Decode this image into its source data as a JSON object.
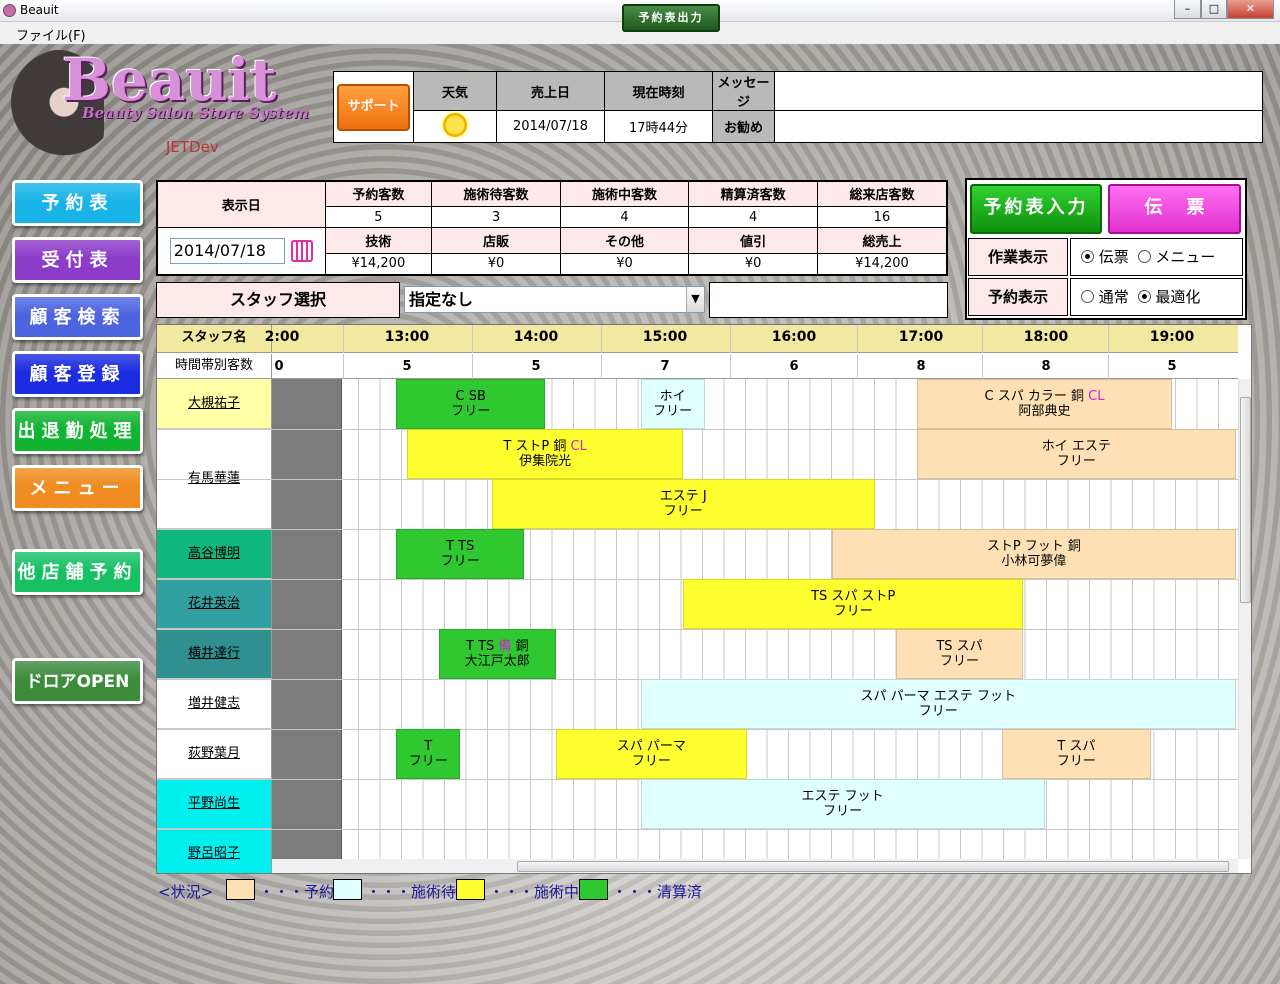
{
  "window": {
    "title": "Beauit",
    "menu_file": "ファイル(F)",
    "min": "–",
    "max": "□",
    "close": "✕"
  },
  "logo": {
    "brand": "Beauit",
    "tagline": "Beauty Salon Store System",
    "dev": "JETDev"
  },
  "support_label": "サポート",
  "info": {
    "h_weather": "天気",
    "h_salesdate": "売上日",
    "h_time": "現在時刻",
    "h_message": "メッセージ",
    "weather_icon": "sun-icon",
    "sales_date": "2014/07/18",
    "current_time": "17時44分",
    "message_label": "お勧め",
    "message_value": ""
  },
  "nav": [
    {
      "label": "予約表",
      "color": "#18b4e8"
    },
    {
      "label": "受付表",
      "color": "#8c3cc8"
    },
    {
      "label": "顧客検索",
      "color": "#4c64e0"
    },
    {
      "label": "顧客登録",
      "color": "#1c2ce0"
    },
    {
      "label": "出退勤処理",
      "color": "#10b430"
    },
    {
      "label": "メニュー",
      "color": "#f08c20"
    },
    {
      "label": "他店舗予約",
      "color": "#18c064"
    },
    {
      "label": "ドロアOPEN",
      "color": "#3c8c3c"
    }
  ],
  "summary": {
    "date_label": "表示日",
    "date_value": "2014/07/18",
    "h1": [
      "予約客数",
      "施術待客数",
      "施術中客数",
      "精算済客数",
      "総来店客数"
    ],
    "v1": [
      "5",
      "3",
      "4",
      "4",
      "16"
    ],
    "h2": [
      "技術",
      "店販",
      "その他",
      "値引",
      "総売上"
    ],
    "v2": [
      "¥14,200",
      "¥0",
      "¥0",
      "¥0",
      "¥14,200"
    ]
  },
  "staff_select": {
    "label": "スタッフ選択",
    "value": "指定なし",
    "output_button": "予約表出力"
  },
  "right": {
    "reserve_input": "予約表入力",
    "slip": "伝票",
    "work_label": "作業表示",
    "work_opt1": "伝票",
    "work_opt2": "メニュー",
    "work_selected": "伝票",
    "resv_label": "予約表示",
    "resv_opt1": "通常",
    "resv_opt2": "最適化",
    "resv_selected": "最適化"
  },
  "schedule": {
    "col_staff": "スタッフ名",
    "row_counts": "時間帯別客数",
    "hours": [
      "2:00",
      "13:00",
      "14:00",
      "15:00",
      "16:00",
      "17:00",
      "18:00",
      "19:00"
    ],
    "counts": [
      "0",
      "5",
      "5",
      "7",
      "6",
      "8",
      "8",
      "5"
    ],
    "staff": [
      {
        "name": "大槻祐子",
        "color": "#ffffa8"
      },
      {
        "name": "有馬華蓮",
        "color": "#ffffff"
      },
      {
        "name": "高谷博明",
        "color": "#10b880"
      },
      {
        "name": "花井英治",
        "color": "#30a0a0"
      },
      {
        "name": "横井達行",
        "color": "#309090"
      },
      {
        "name": "増井健志",
        "color": "#ffffff"
      },
      {
        "name": "荻野葉月",
        "color": "#ffffff"
      },
      {
        "name": "平野尚生",
        "color": "#00f0f0"
      },
      {
        "name": "野呂昭子",
        "color": "#00f0f0"
      }
    ],
    "blocks": [
      {
        "row": 0,
        "start": "12:55",
        "end": "14:05",
        "status": "清算済",
        "l1": "C SB",
        "cl": "",
        "l2": "フリー"
      },
      {
        "row": 0,
        "start": "14:50",
        "end": "15:20",
        "status": "施術待",
        "l1": "ホイ",
        "cl": "",
        "l2": "フリー"
      },
      {
        "row": 0,
        "start": "17:00",
        "end": "19:00",
        "status": "予約",
        "l1": "C スパ カラー 銅 ",
        "cl": "CL",
        "l2": "阿部典史"
      },
      {
        "row": 1,
        "start": "13:00",
        "end": "15:10",
        "status": "施術中",
        "l1": "T ストP 銅 ",
        "cl": "CL",
        "l2": "伊集院光"
      },
      {
        "row": 1,
        "start": "17:00",
        "end": "19:30",
        "status": "予約",
        "l1": "ホイ エステ",
        "cl": "",
        "l2": "フリー"
      },
      {
        "row": 1.5,
        "start": "13:40",
        "end": "16:40",
        "status": "施術中",
        "l1": "エステ J",
        "cl": "",
        "l2": "フリー"
      },
      {
        "row": 2,
        "start": "12:55",
        "end": "13:55",
        "status": "清算済",
        "l1": "T TS",
        "cl": "",
        "l2": "フリー"
      },
      {
        "row": 2,
        "start": "16:20",
        "end": "19:30",
        "status": "予約",
        "l1": "ストP フット 銅",
        "cl": "",
        "l2": "小林可夢偉"
      },
      {
        "row": 3,
        "start": "15:10",
        "end": "17:50",
        "status": "施術中",
        "l1": "TS スパ ストP",
        "cl": "",
        "l2": "フリー"
      },
      {
        "row": 4,
        "start": "13:15",
        "end": "14:10",
        "status": "清算済",
        "l1": "T TS ",
        "cl": "備",
        "l2": "大江戸太郎",
        "tail": " 銅"
      },
      {
        "row": 4,
        "start": "16:50",
        "end": "17:50",
        "status": "予約",
        "l1": "TS スパ",
        "cl": "",
        "l2": "フリー"
      },
      {
        "row": 5,
        "start": "14:50",
        "end": "19:30",
        "status": "施術待",
        "l1": "スパ パーマ エステ フット",
        "cl": "",
        "l2": "フリー"
      },
      {
        "row": 6,
        "start": "12:55",
        "end": "13:25",
        "status": "清算済",
        "l1": "T",
        "cl": "",
        "l2": "フリー"
      },
      {
        "row": 6,
        "start": "14:10",
        "end": "15:40",
        "status": "施術中",
        "l1": "スパ パーマ",
        "cl": "",
        "l2": "フリー"
      },
      {
        "row": 6,
        "start": "17:40",
        "end": "18:50",
        "status": "予約",
        "l1": "T スパ",
        "cl": "",
        "l2": "フリー"
      },
      {
        "row": 7,
        "start": "14:50",
        "end": "18:00",
        "status": "施術待",
        "l1": "エステ フット",
        "cl": "",
        "l2": "フリー"
      }
    ]
  },
  "legend": {
    "title": "<状況>",
    "items": [
      {
        "label": "・・・予約",
        "color": "#ffe0b4"
      },
      {
        "label": "・・・施術待",
        "color": "#e0ffff"
      },
      {
        "label": "・・・施術中",
        "color": "#ffff30"
      },
      {
        "label": "・・・清算済",
        "color": "#30c830"
      }
    ]
  },
  "status_colors": {
    "予約": "#ffe0b4",
    "施術待": "#e0ffff",
    "施術中": "#ffff30",
    "清算済": "#30c830"
  }
}
